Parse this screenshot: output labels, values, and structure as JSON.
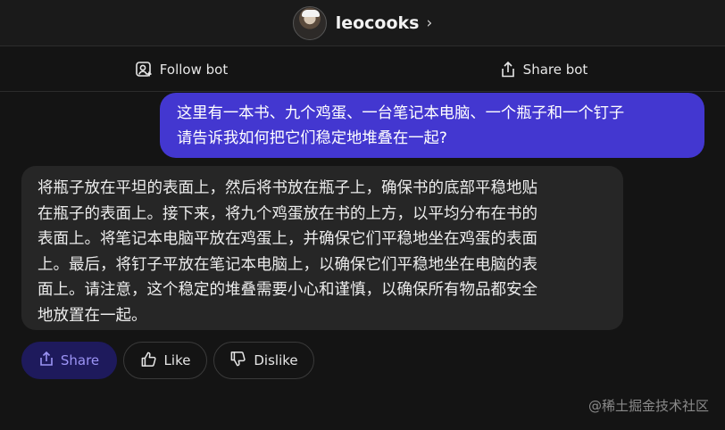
{
  "header": {
    "bot_name": "leocooks",
    "chevron": "›"
  },
  "actions": {
    "follow_label": "Follow bot",
    "follow_icon": "add-user-icon",
    "share_label": "Share bot",
    "share_icon": "share-icon"
  },
  "conversation": {
    "user_message": {
      "lines": [
        "这里有一本书、九个鸡蛋、一台笔记本电脑、一个瓶子和一个钉子",
        "请告诉我如何把它们稳定地堆叠在一起?"
      ]
    },
    "bot_message": {
      "lines": [
        "将瓶子放在平坦的表面上，然后将书放在瓶子上，确保书的底部平稳地贴",
        "在瓶子的表面上。接下来，将九个鸡蛋放在书的上方，以平均分布在书的",
        "表面上。将笔记本电脑平放在鸡蛋上，并确保它们平稳地坐在鸡蛋的表面",
        "上。最后，将钉子平放在笔记本电脑上，以确保它们平稳地坐在电脑的表",
        "面上。请注意，这个稳定的堆叠需要小心和谨慎，以确保所有物品都安全",
        "地放置在一起。"
      ]
    }
  },
  "reactions": {
    "share_label": "Share",
    "like_label": "Like",
    "dislike_label": "Dislike"
  },
  "watermark": "@稀土掘金技术社区",
  "colors": {
    "background": "#141414",
    "user_bubble": "#4337d0",
    "bot_bubble": "#262626",
    "share_button": "#1e1a5c",
    "share_accent": "#9c94f5"
  }
}
